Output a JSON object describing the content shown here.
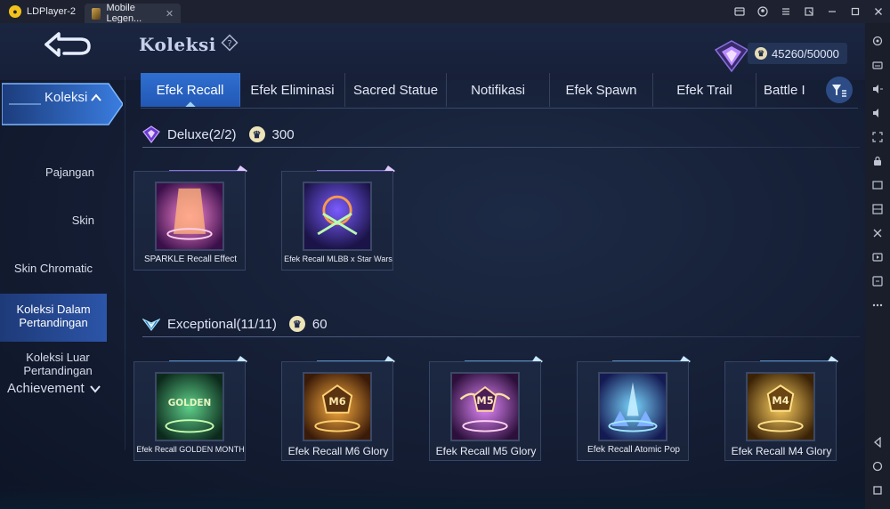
{
  "titlebar": {
    "app_name": "LDPlayer-2",
    "game_tab": "Mobile Legen...",
    "tab_close": "✕",
    "controls": [
      "gamepad-icon",
      "user-icon",
      "menu-icon",
      "pin-icon",
      "minimize-icon",
      "maximize-icon",
      "close-icon"
    ]
  },
  "header": {
    "title": "Koleksi",
    "currency": "45260/50000"
  },
  "sidebar": {
    "active_label": "Koleksi",
    "items": [
      "Pajangan",
      "Skin",
      "Skin Chromatic",
      "Koleksi Dalam Pertandingan",
      "Koleksi Luar Pertandingan"
    ],
    "achievement": "Achievement"
  },
  "tabs": [
    "Efek Recall",
    "Efek Eliminasi",
    "Sacred Statue",
    "Notifikasi",
    "Efek Spawn",
    "Efek Trail",
    "Battle I"
  ],
  "sections": {
    "deluxe": {
      "title": "Deluxe(2/2)",
      "points": "300",
      "cards": [
        "SPARKLE Recall Effect",
        "Efek Recall MLBB x Star Wars"
      ]
    },
    "exceptional": {
      "title": "Exceptional(11/11)",
      "points": "60",
      "cards": [
        "Efek Recall GOLDEN MONTH",
        "Efek Recall M6 Glory",
        "Efek Recall M5 Glory",
        "Efek Recall Atomic Pop",
        "Efek Recall M4 Glory"
      ]
    }
  },
  "thumb_text": {
    "golden": "GOLDEN",
    "m6": "M6",
    "m5": "M5",
    "m4": "M4"
  },
  "colors": {
    "accent_tab": "#2f6fd0",
    "sidebar_selected": "#2c55a8",
    "background": "#141d33"
  }
}
